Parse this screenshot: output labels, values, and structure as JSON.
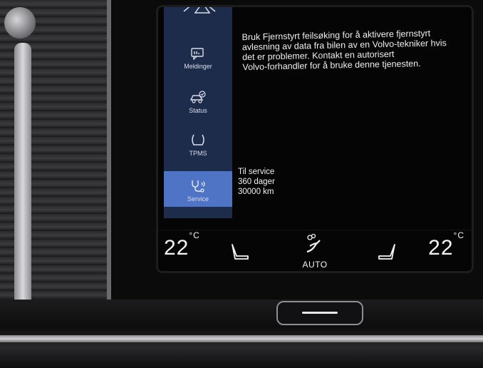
{
  "sidebar": {
    "items": [
      {
        "label": "Meldinger",
        "icon": "message-icon"
      },
      {
        "label": "Status",
        "icon": "car-check-icon"
      },
      {
        "label": "TPMS",
        "icon": "tire-pressure-icon"
      },
      {
        "label": "Service",
        "icon": "service-stethoscope-icon",
        "active": true
      }
    ]
  },
  "message": {
    "line1": "Bruk Fjernstyrt feilsøking for å aktivere fjernstyrt",
    "line2": "avlesning av data fra bilen av en Volvo-tekniker hvis",
    "line3": "det er problemer. Kontakt en autorisert",
    "line4": "Volvo-forhandler for å bruke denne tjenesten."
  },
  "service": {
    "title": "Til service",
    "days": "360 dager",
    "distance": "30000 km"
  },
  "climate": {
    "left_temp": "22",
    "right_temp": "22",
    "unit": "°C",
    "auto_label": "AUTO"
  },
  "colors": {
    "sidebar_bg": "#1d2c4a",
    "active_item": "#4f74c6",
    "screen_bg": "#050506"
  }
}
